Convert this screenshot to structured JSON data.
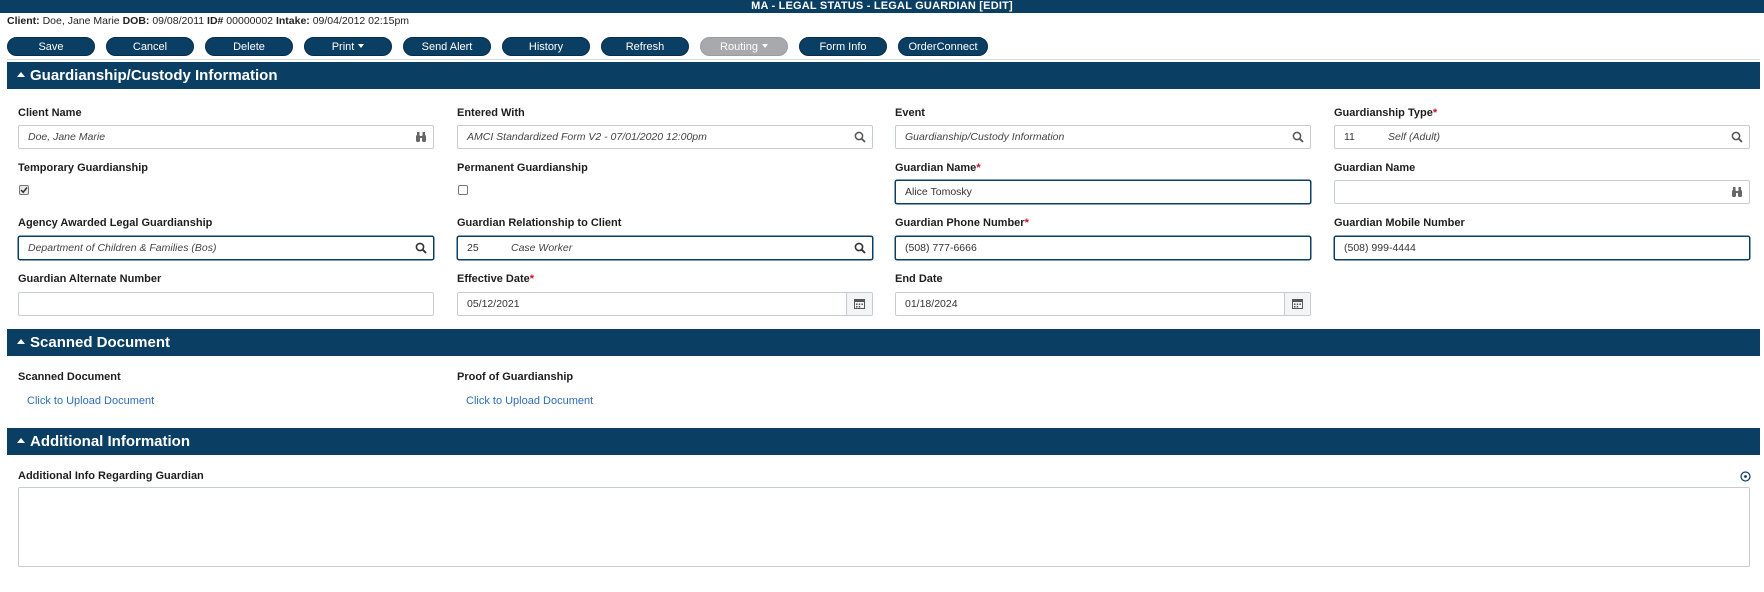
{
  "window": {
    "title": "MA - LEGAL STATUS - LEGAL GUARDIAN [EDIT]"
  },
  "client_bar": {
    "client_label": "Client:",
    "client_value": "Doe, Jane Marie",
    "dob_label": "DOB:",
    "dob_value": "09/08/2011",
    "id_label": "ID#",
    "id_value": "00000002",
    "intake_label": "Intake:",
    "intake_value": "09/04/2012 02:15pm"
  },
  "toolbar": {
    "save": "Save",
    "cancel": "Cancel",
    "delete": "Delete",
    "print": "Print",
    "send_alert": "Send Alert",
    "history": "History",
    "refresh": "Refresh",
    "routing": "Routing",
    "form_info": "Form Info",
    "order_connect": "OrderConnect"
  },
  "sections": {
    "guardianship": {
      "title": "Guardianship/Custody Information",
      "client_name": {
        "label": "Client Name",
        "value": "Doe, Jane Marie",
        "icon": "binoculars-icon"
      },
      "entered_with": {
        "label": "Entered With",
        "value": "AMCI Standardized Form V2 - 07/01/2020 12:00pm",
        "icon": "search-icon"
      },
      "event": {
        "label": "Event",
        "value": "Guardianship/Custody Information",
        "icon": "search-icon"
      },
      "guardianship_type": {
        "label": "Guardianship Type",
        "required": "*",
        "code": "11",
        "value": "Self (Adult)",
        "icon": "search-icon"
      },
      "temporary_guardianship": {
        "label": "Temporary Guardianship",
        "checked": true
      },
      "permanent_guardianship": {
        "label": "Permanent Guardianship",
        "checked": false
      },
      "guardian_name_required": {
        "label": "Guardian Name",
        "required": "*",
        "value": "Alice Tomosky"
      },
      "guardian_name_lookup": {
        "label": "Guardian Name",
        "value": "",
        "icon": "binoculars-icon"
      },
      "agency_awarded": {
        "label": "Agency Awarded Legal Guardianship",
        "value": "Department of Children & Families (Bos)",
        "icon": "search-icon"
      },
      "relationship": {
        "label": "Guardian Relationship to Client",
        "code": "25",
        "value": "Case Worker",
        "icon": "search-icon"
      },
      "phone": {
        "label": "Guardian Phone Number",
        "required": "*",
        "value": "(508) 777-6666"
      },
      "mobile": {
        "label": "Guardian Mobile Number",
        "value": "(508) 999-4444"
      },
      "alternate": {
        "label": "Guardian Alternate Number",
        "value": ""
      },
      "effective_date": {
        "label": "Effective Date",
        "required": "*",
        "value": "05/12/2021",
        "icon": "calendar-icon"
      },
      "end_date": {
        "label": "End Date",
        "value": "01/18/2024",
        "icon": "calendar-icon"
      }
    },
    "scanned": {
      "title": "Scanned Document",
      "scanned_document": {
        "label": "Scanned Document",
        "link": "Click to Upload Document"
      },
      "proof": {
        "label": "Proof of Guardianship",
        "link": "Click to Upload Document"
      }
    },
    "additional": {
      "title": "Additional Information",
      "info_label": "Additional Info Regarding Guardian",
      "info_value": "",
      "icon": "info-circle-icon"
    }
  },
  "colors": {
    "header_bg": "#0b3e63",
    "required": "#c8102e",
    "link": "#2e6db4",
    "disabled_button": "#a7a9ac"
  }
}
